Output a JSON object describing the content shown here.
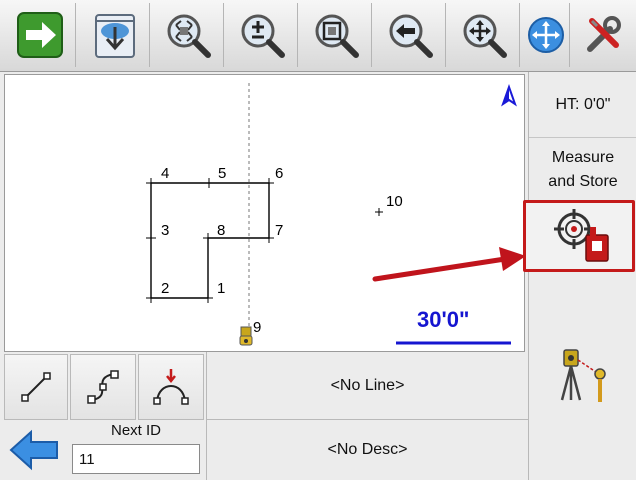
{
  "toolbar": {
    "buttons": [
      {
        "name": "exit-button",
        "icon": "green-arrow-right-icon"
      },
      {
        "name": "load-file-button",
        "icon": "file-download-icon"
      },
      {
        "name": "zoom-extents-button",
        "icon": "zoom-extents-icon"
      },
      {
        "name": "zoom-in-out-button",
        "icon": "zoom-plus-minus-icon"
      },
      {
        "name": "zoom-window-button",
        "icon": "zoom-window-icon"
      },
      {
        "name": "zoom-previous-button",
        "icon": "zoom-previous-icon"
      },
      {
        "name": "pan-button",
        "icon": "pan-icon"
      },
      {
        "name": "pan-mode-button",
        "icon": "globe-pan-icon"
      },
      {
        "name": "tools-button",
        "icon": "wrench-screwdriver-icon"
      }
    ]
  },
  "map": {
    "points": [
      {
        "id": "4",
        "label": "4"
      },
      {
        "id": "5",
        "label": "5"
      },
      {
        "id": "6",
        "label": "6"
      },
      {
        "id": "3",
        "label": "3"
      },
      {
        "id": "8",
        "label": "8"
      },
      {
        "id": "7",
        "label": "7"
      },
      {
        "id": "2",
        "label": "2"
      },
      {
        "id": "1",
        "label": "1"
      },
      {
        "id": "10",
        "label": "10"
      },
      {
        "id": "9",
        "label": "9"
      }
    ],
    "scale_label": "30'0\"",
    "north_icon": "north-arrow-icon",
    "colors": {
      "scale": "#1515d0",
      "arrow": "#c0141c",
      "north": "#1a1ad8"
    }
  },
  "right_panel": {
    "ht_label": "HT: 0'0\"",
    "measure_store_line1": "Measure",
    "measure_store_line2": "and Store",
    "measure_store_icon": "crosshair-target-icon",
    "survey_icon": "total-station-rod-icon"
  },
  "bottom": {
    "line_tools": [
      {
        "name": "draw-line-button",
        "icon": "line-segment-icon"
      },
      {
        "name": "draw-curve-button",
        "icon": "curve-icon"
      },
      {
        "name": "draw-arc-button",
        "icon": "arc-icon"
      }
    ],
    "line_value": "<No Line>",
    "desc_value": "<No Desc>",
    "next_id_label": "Next ID",
    "next_id_value": "11",
    "back_icon": "blue-arrow-left-icon"
  }
}
